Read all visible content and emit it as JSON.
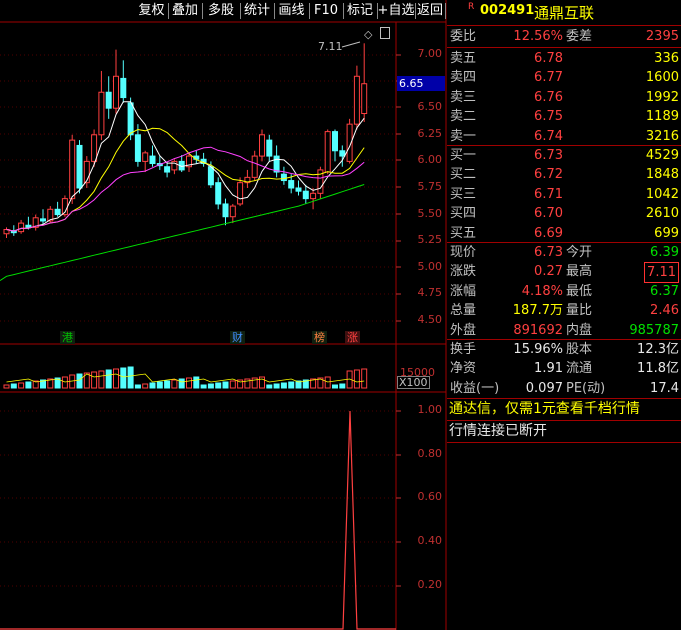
{
  "toolbar": {
    "items": [
      "复权",
      "叠加",
      "多股",
      "统计",
      "画线",
      "F10",
      "标记",
      "+自选",
      "返回"
    ]
  },
  "stock": {
    "flag": "R",
    "code": "002491",
    "name": "通鼎互联"
  },
  "price_axis": {
    "ticks": [
      "7.00",
      "6.75",
      "6.50",
      "6.25",
      "6.00",
      "5.75",
      "5.50",
      "5.25",
      "5.00",
      "4.75",
      "4.50"
    ],
    "current_label": "6.65",
    "high_annotation": "7.11"
  },
  "event_marks": [
    {
      "text": "港",
      "color": "#00c000"
    },
    {
      "text": "财",
      "color": "#4090ff"
    },
    {
      "text": "榜",
      "color": "#ff8040"
    },
    {
      "text": "涨",
      "color": "#ff4040"
    }
  ],
  "volume_axis": {
    "tick": "15000",
    "unit": "X100"
  },
  "indicator_axis": {
    "ticks": [
      "1.00",
      "0.80",
      "0.60",
      "0.40",
      "0.20"
    ]
  },
  "quote": {
    "weibi": {
      "label": "委比",
      "value": "12.56%",
      "label2": "委差",
      "value2": "2395"
    },
    "asks": [
      {
        "label": "卖五",
        "price": "6.78",
        "volume": "336"
      },
      {
        "label": "卖四",
        "price": "6.77",
        "volume": "1600"
      },
      {
        "label": "卖三",
        "price": "6.76",
        "volume": "1992"
      },
      {
        "label": "卖二",
        "price": "6.75",
        "volume": "1189"
      },
      {
        "label": "卖一",
        "price": "6.74",
        "volume": "3216"
      }
    ],
    "bids": [
      {
        "label": "买一",
        "price": "6.73",
        "volume": "4529"
      },
      {
        "label": "买二",
        "price": "6.72",
        "volume": "1848"
      },
      {
        "label": "买三",
        "price": "6.71",
        "volume": "1042"
      },
      {
        "label": "买四",
        "price": "6.70",
        "volume": "2610"
      },
      {
        "label": "买五",
        "price": "6.69",
        "volume": "699"
      }
    ],
    "stats1": [
      {
        "l": "现价",
        "v": "6.73",
        "l2": "今开",
        "v2": "6.39"
      },
      {
        "l": "涨跌",
        "v": "0.27",
        "l2": "最高",
        "v2": "7.11"
      },
      {
        "l": "涨幅",
        "v": "4.18%",
        "l2": "最低",
        "v2": "6.37"
      },
      {
        "l": "总量",
        "v": "187.7万",
        "l2": "量比",
        "v2": "2.46"
      },
      {
        "l": "外盘",
        "v": "891692",
        "l2": "内盘",
        "v2": "985787"
      }
    ],
    "stats2": [
      {
        "l": "换手",
        "v": "15.96%",
        "l2": "股本",
        "v2": "12.3亿"
      },
      {
        "l": "净资",
        "v": "1.91",
        "l2": "流通",
        "v2": "11.8亿"
      },
      {
        "l": "收益(一)",
        "v": "0.097",
        "l2": "PE(动)",
        "v2": "17.4"
      }
    ]
  },
  "messages": {
    "ad": "通达信，仅需1元查看千档行情",
    "status": "行情连接已断开"
  },
  "colors": {
    "up": "#ff4040",
    "down": "#54ffff",
    "ma5": "#ffffff",
    "ma10": "#ffff00",
    "ma20": "#ff40ff",
    "ma60": "#00e000",
    "border": "#a00000"
  }
}
